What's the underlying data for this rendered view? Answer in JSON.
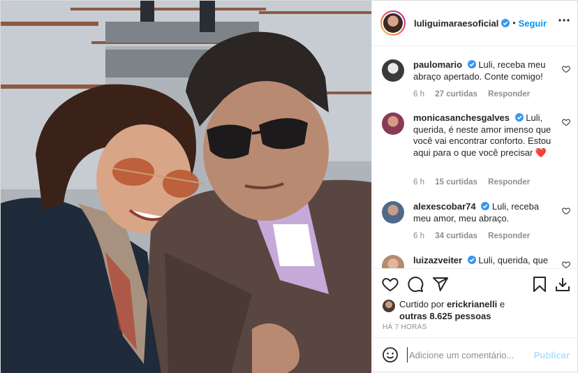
{
  "post": {
    "image_alt": "Selfie of a smiling couple wearing sunglasses outdoors on bleachers"
  },
  "header": {
    "username": "luliguimaraesoficial",
    "separator": "•",
    "follow_label": "Seguir",
    "more_icon": "more-horizontal-icon"
  },
  "comments": [
    {
      "username": "paulomario",
      "text": "Luli, receba meu abraço apertado. Conte comigo!",
      "age": "6 h",
      "likes": "27 curtidas",
      "reply": "Responder",
      "avatar_color": "#3a3a3a"
    },
    {
      "username": "monicasanchesgalves",
      "text": "Luli, querida, é neste amor imenso que você vai encontrar conforto. Estou aqui para o que você precisar ❤️",
      "age": "6 h",
      "likes": "15 curtidas",
      "reply": "Responder",
      "avatar_color": "#8a3a58"
    },
    {
      "username": "alexescobar74",
      "text": "Luli, receba meu amor, meu abraço.",
      "age": "6 h",
      "likes": "34 curtidas",
      "reply": "Responder",
      "avatar_color": "#4d6a8a"
    },
    {
      "username": "luizazveiter",
      "text": "Luli, querida, que",
      "avatar_color": "#b58a6e"
    }
  ],
  "actions": {
    "like_icon": "heart-icon",
    "comment_icon": "comment-icon",
    "share_icon": "share-icon",
    "save_icon": "bookmark-icon",
    "download_icon": "download-icon"
  },
  "liked_by": {
    "prefix": "Curtido por",
    "user": "erickrianelli",
    "conj": "e",
    "others": "outras 8.625 pessoas"
  },
  "timestamp": "HÁ 7 HORAS",
  "add_comment": {
    "placeholder": "Adicione um comentário...",
    "publish_label": "Publicar"
  },
  "colors": {
    "accent": "#0095f6",
    "verified": "#3897f0",
    "publish_disabled": "#b2dffc",
    "heart_red": "#ed4956"
  }
}
